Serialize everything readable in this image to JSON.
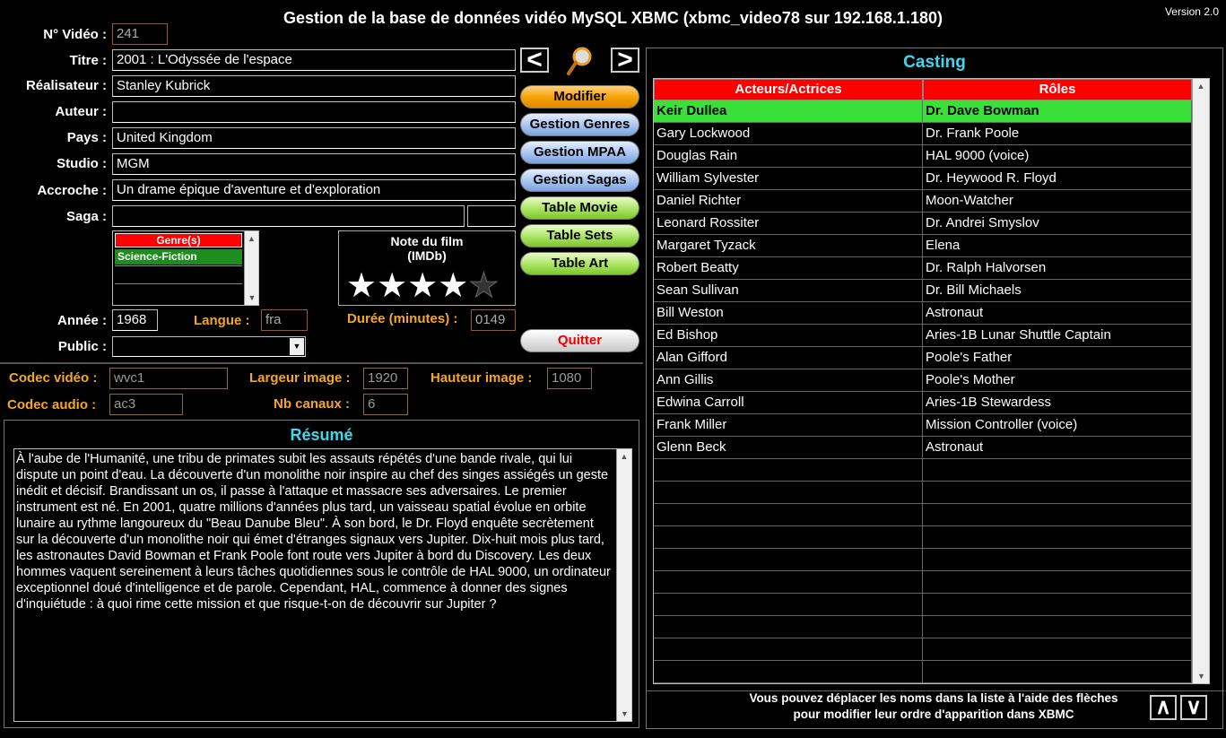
{
  "header": {
    "title": "Gestion de la base de données vidéo MySQL XBMC (xbmc_video78 sur 192.168.1.180)",
    "version": "Version 2.0"
  },
  "form": {
    "video_no_label": "N° Vidéo :",
    "video_no": "241",
    "titre_label": "Titre :",
    "titre": "2001 : L'Odyssée de l'espace",
    "realisateur_label": "Réalisateur :",
    "realisateur": "Stanley Kubrick",
    "auteur_label": "Auteur :",
    "auteur": "",
    "pays_label": "Pays :",
    "pays": "United Kingdom",
    "studio_label": "Studio :",
    "studio": "MGM",
    "accroche_label": "Accroche :",
    "accroche": "Un drame épique d'aventure et d'exploration",
    "saga_label": "Saga :",
    "saga": "",
    "saga_extra": "",
    "annee_label": "Année :",
    "annee": "1968",
    "langue_label": "Langue :",
    "langue": "fra",
    "duree_label": "Durée (minutes) :",
    "duree": "0149",
    "public_label": "Public :",
    "public": ""
  },
  "genres": {
    "header": "Genre(s)",
    "items": [
      "Science-Fiction"
    ]
  },
  "rating": {
    "title_line1": "Note du film",
    "title_line2": "(IMDb)",
    "stars_filled": 4,
    "stars_total": 5
  },
  "buttons": {
    "modifier": "Modifier",
    "gestion_genres": "Gestion Genres",
    "gestion_mpaa": "Gestion MPAA",
    "gestion_sagas": "Gestion Sagas",
    "table_movie": "Table Movie",
    "table_sets": "Table Sets",
    "table_art": "Table Art",
    "quitter": "Quitter",
    "prev": "<",
    "next": ">"
  },
  "tech": {
    "codec_video_label": "Codec vidéo :",
    "codec_video": "wvc1",
    "largeur_label": "Largeur image :",
    "largeur": "1920",
    "hauteur_label": "Hauteur image :",
    "hauteur": "1080",
    "codec_audio_label": "Codec audio :",
    "codec_audio": "ac3",
    "canaux_label": "Nb canaux :",
    "canaux": "6"
  },
  "resume": {
    "title": "Résumé",
    "text": "À l'aube de l'Humanité, une tribu de primates subit les assauts répétés d'une bande rivale, qui lui dispute un point d'eau. La découverte d'un monolithe noir inspire au chef des singes assiégés un geste inédit et décisif. Brandissant un os, il passe à l'attaque et massacre ses adversaires. Le premier instrument est né. En 2001, quatre millions d'années plus tard, un vaisseau spatial évolue en orbite lunaire au rythme langoureux du \"Beau Danube Bleu\". À son bord, le Dr. Floyd enquête secrètement sur la découverte d'un monolithe noir qui émet d'étranges signaux vers Jupiter. Dix-huit mois plus tard, les astronautes David Bowman et Frank Poole font route vers Jupiter à bord du Discovery. Les deux hommes vaquent sereinement à leurs tâches quotidiennes sous le contrôle de HAL 9000, un ordinateur exceptionnel doué d'intelligence et de parole. Cependant, HAL, commence à donner des signes d'inquiétude : à quoi rime cette mission et que risque-t-on de découvrir sur Jupiter ?"
  },
  "casting": {
    "title": "Casting",
    "col_actors": "Acteurs/Actrices",
    "col_roles": "Rôles",
    "rows": [
      {
        "actor": "Keir Dullea",
        "role": "Dr. Dave Bowman"
      },
      {
        "actor": "Gary Lockwood",
        "role": "Dr. Frank Poole"
      },
      {
        "actor": "Douglas Rain",
        "role": "HAL 9000 (voice)"
      },
      {
        "actor": "William Sylvester",
        "role": "Dr. Heywood R. Floyd"
      },
      {
        "actor": "Daniel Richter",
        "role": "Moon-Watcher"
      },
      {
        "actor": "Leonard Rossiter",
        "role": "Dr. Andrei Smyslov"
      },
      {
        "actor": "Margaret Tyzack",
        "role": "Elena"
      },
      {
        "actor": "Robert Beatty",
        "role": "Dr. Ralph Halvorsen"
      },
      {
        "actor": "Sean Sullivan",
        "role": "Dr. Bill Michaels"
      },
      {
        "actor": "Bill Weston",
        "role": "Astronaut"
      },
      {
        "actor": "Ed Bishop",
        "role": "Aries-1B Lunar Shuttle Captain"
      },
      {
        "actor": "Alan Gifford",
        "role": "Poole's Father"
      },
      {
        "actor": "Ann Gillis",
        "role": "Poole's Mother"
      },
      {
        "actor": "Edwina Carroll",
        "role": "Aries-1B Stewardess"
      },
      {
        "actor": "Frank Miller",
        "role": "Mission Controller (voice)"
      },
      {
        "actor": "Glenn Beck",
        "role": "Astronaut"
      }
    ],
    "empty_rows": 10,
    "hint_line1": "Vous pouvez déplacer les noms dans la liste à l'aide des flèches",
    "hint_line2": "pour modifier leur ordre d'apparition dans XBMC",
    "up_arrow": "∧",
    "down_arrow": "∨"
  }
}
